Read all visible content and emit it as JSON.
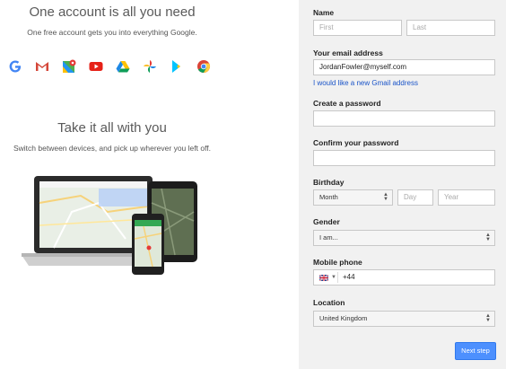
{
  "left": {
    "title": "One account is all you need",
    "subtitle": "One free account gets you into everything Google.",
    "title2": "Take it all with you",
    "subtitle2": "Switch between devices, and pick up wherever you left off.",
    "product_icons": [
      "google-g-icon",
      "gmail-icon",
      "maps-icon",
      "youtube-icon",
      "drive-icon",
      "photos-icon",
      "play-icon",
      "chrome-icon"
    ]
  },
  "form": {
    "name_label": "Name",
    "first_placeholder": "First",
    "last_placeholder": "Last",
    "email_label": "Your email address",
    "email_value": "JordanFowler@myself.com",
    "gmail_link": "I would like a new Gmail address",
    "password_label": "Create a password",
    "confirm_label": "Confirm your password",
    "birthday_label": "Birthday",
    "month_value": "Month",
    "day_placeholder": "Day",
    "year_placeholder": "Year",
    "gender_label": "Gender",
    "gender_value": "I am...",
    "mobile_label": "Mobile phone",
    "phone_code": "+44",
    "location_label": "Location",
    "location_value": "United Kingdom",
    "next_button": "Next step"
  },
  "colors": {
    "panel": "#f1f1f1",
    "link": "#1a54c8",
    "button": "#4d90fe"
  }
}
